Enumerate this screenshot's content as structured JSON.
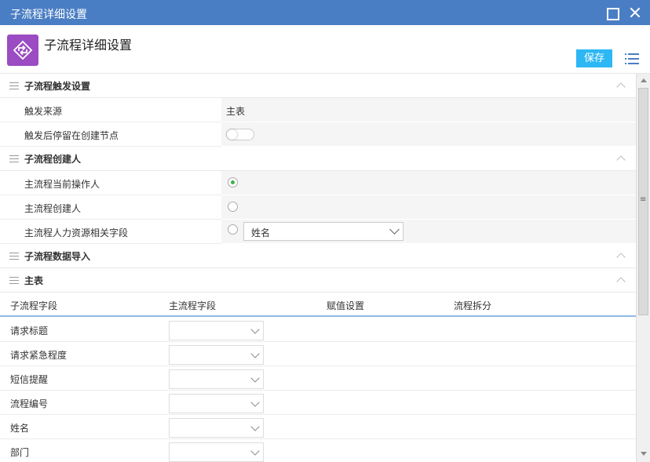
{
  "window": {
    "title": "子流程详细设置"
  },
  "header": {
    "title": "子流程详细设置",
    "save_label": "保存"
  },
  "sections": {
    "trigger": {
      "title": "子流程触发设置",
      "rows": [
        {
          "label": "触发来源",
          "value": "主表"
        },
        {
          "label": "触发后停留在创建节点",
          "toggle": "off"
        }
      ]
    },
    "creator": {
      "title": "子流程创建人",
      "options": [
        {
          "label": "主流程当前操作人",
          "selected": true
        },
        {
          "label": "主流程创建人",
          "selected": false
        },
        {
          "label": "主流程人力资源相关字段",
          "selected": false,
          "select_value": "姓名"
        }
      ]
    },
    "data_import": {
      "title": "子流程数据导入"
    },
    "main_table": {
      "title": "主表",
      "columns": [
        "子流程字段",
        "主流程字段",
        "赋值设置",
        "流程拆分"
      ],
      "rows": [
        {
          "field": "请求标题",
          "main_field": ""
        },
        {
          "field": "请求紧急程度",
          "main_field": ""
        },
        {
          "field": "短信提醒",
          "main_field": ""
        },
        {
          "field": "流程编号",
          "main_field": ""
        },
        {
          "field": "姓名",
          "main_field": ""
        },
        {
          "field": "部门",
          "main_field": ""
        }
      ]
    }
  },
  "colors": {
    "titlebar": "#4a7ec4",
    "app_icon": "#9b4cc2",
    "save_button": "#2db7f5",
    "radio_selected": "#3cb34a"
  },
  "icons": {
    "app": "subflow-icon",
    "menu": "list-menu-icon"
  }
}
